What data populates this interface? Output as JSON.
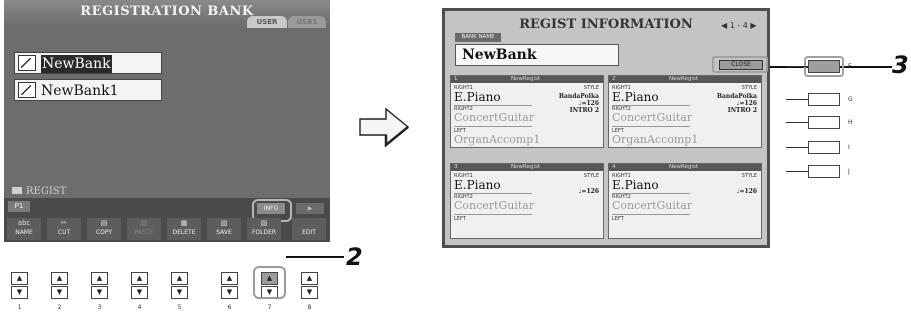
{
  "left_screen": {
    "title": "REGISTRATION BANK",
    "tabs": [
      "USER",
      "USB1"
    ],
    "banks": [
      {
        "name": "NewBank",
        "selected": true
      },
      {
        "name": "NewBank1",
        "selected": false
      }
    ],
    "folder_label": "REGIST",
    "page_label": "P1",
    "info_label": "INFO",
    "page_arrow_label": "▶",
    "functions": [
      {
        "label": "NAME",
        "icon": "abc"
      },
      {
        "label": "CUT",
        "icon": "✂"
      },
      {
        "label": "COPY",
        "icon": "▤"
      },
      {
        "label": "PASTE",
        "icon": "▥"
      },
      {
        "label": "DELETE",
        "icon": "▦"
      },
      {
        "label": "SAVE",
        "icon": "▧"
      },
      {
        "label": "FOLDER",
        "icon": "▨"
      },
      {
        "label": "EDIT",
        "icon": ""
      }
    ],
    "button_numbers": [
      "1",
      "2",
      "3",
      "4",
      "5",
      "6",
      "7",
      "8"
    ],
    "highlighted_button": "7",
    "step_callout": "2"
  },
  "right_screen": {
    "title": "REGIST INFORMATION",
    "page_indicator": "◀ 1 - 4 ▶",
    "bank_name_label": "BANK NAME",
    "bank_name": "NewBank",
    "close_label": "CLOSE",
    "panels": [
      {
        "num": "1",
        "name": "NewRegist",
        "right1_label": "RIGHT1",
        "right1": "E.Piano",
        "style_label": "STYLE",
        "style": "BandaPolka",
        "tempo": "♩=126",
        "intro": "INTRO 2",
        "right2_label": "RIGHT2",
        "right2": "ConcertGuitar",
        "left_label": "LEFT",
        "left": "OrganAccomp1"
      },
      {
        "num": "2",
        "name": "NewRegist",
        "right1_label": "RIGHT1",
        "right1": "E.Piano",
        "style_label": "STYLE",
        "style": "BandaPolka",
        "tempo": "♩=126",
        "intro": "INTRO 2",
        "right2_label": "RIGHT2",
        "right2": "ConcertGuitar",
        "left_label": "LEFT",
        "left": "OrganAccomp1"
      },
      {
        "num": "3",
        "name": "NewRegist",
        "right1_label": "RIGHT1",
        "right1": "E.Piano",
        "style_label": "STYLE",
        "style": "",
        "tempo": "♩=126",
        "intro": "",
        "right2_label": "RIGHT2",
        "right2": "ConcertGuitar",
        "left_label": "LEFT",
        "left": ""
      },
      {
        "num": "4",
        "name": "NewRegist",
        "right1_label": "RIGHT1",
        "right1": "E.Piano",
        "style_label": "STYLE",
        "style": "",
        "tempo": "♩=126",
        "intro": "",
        "right2_label": "RIGHT2",
        "right2": "ConcertGuitar",
        "left_label": "LEFT",
        "left": ""
      }
    ],
    "side_buttons": [
      "F",
      "G",
      "H",
      "I",
      "J"
    ],
    "highlighted_side_button": "F",
    "step_callout": "3"
  },
  "arrow_icon": "right-arrow-icon"
}
